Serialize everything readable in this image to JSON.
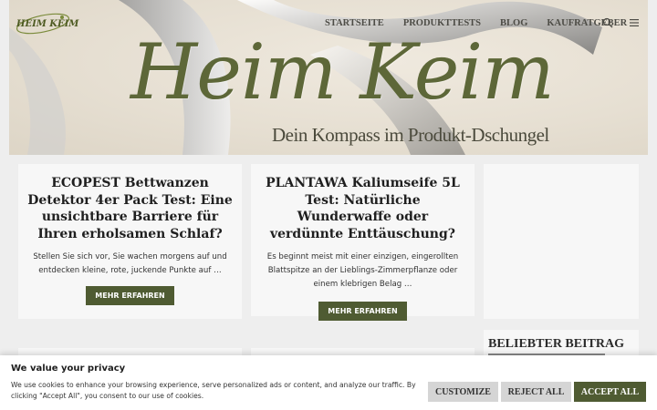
{
  "hero": {
    "title": "Heim Keim",
    "subtitle": "Dein Kompass im Produkt-Dschungel"
  },
  "logo": {
    "text": "HEIM KEIM"
  },
  "nav": {
    "items": [
      "STARTSEITE",
      "PRODUKTTESTS",
      "BLOG",
      "KAUFRATGEBER"
    ],
    "search_icon": "search-icon",
    "menu_icon": "menu-icon"
  },
  "posts": [
    {
      "title": "ECOPEST Bettwanzen Detektor 4er Pack Test: Eine unsichtbare Barriere für Ihren erholsamen Schlaf?",
      "excerpt": "Stellen Sie sich vor, Sie wachen morgens auf und entdecken kleine, rote, juckende Punkte auf …",
      "button": "MEHR ERFAHREN"
    },
    {
      "title": "PLANTAWA Kaliumseife 5L Test: Natürliche Wunderwaffe oder verdünnte Enttäuschung?",
      "excerpt": "Es beginnt meist mit einer einzigen, eingerollten Blattspitze an der Lieblings-Zimmerpflanze oder einem klebrigen Belag …",
      "button": "MEHR ERFAHREN"
    }
  ],
  "sidebar": {
    "heading": "BELIEBTER BEITRAG"
  },
  "cookie": {
    "title": "We value your privacy",
    "text": "We use cookies to enhance your browsing experience, serve personalized ads or content, and analyze our traffic. By clicking \"Accept All\", you consent to our use of cookies.",
    "customize": "CUSTOMIZE",
    "reject": "REJECT ALL",
    "accept": "ACCEPT ALL"
  },
  "colors": {
    "brand": "#4f5b32",
    "hero_text": "#5d6738",
    "background": "#eeeeee",
    "card": "#f7f7f7"
  }
}
